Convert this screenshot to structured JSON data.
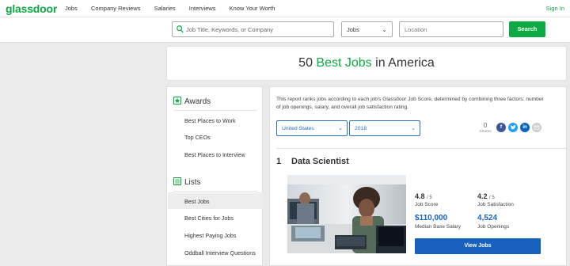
{
  "brand": {
    "logo_text": "glassdoor",
    "accent_color": "#0caa41",
    "link_color": "#1861bf"
  },
  "nav": {
    "links": [
      "Jobs",
      "Company Reviews",
      "Salaries",
      "Interviews",
      "Know Your Worth"
    ],
    "sign_in": "Sign In"
  },
  "search": {
    "keyword_placeholder": "Job Title, Keywords, or Company",
    "category_value": "Jobs",
    "location_placeholder": "Location",
    "button_label": "Search"
  },
  "page": {
    "title_prefix": "50 ",
    "title_accent": "Best Jobs",
    "title_suffix": " in America"
  },
  "sidebar": {
    "awards": {
      "heading": "Awards",
      "items": [
        "Best Places to Work",
        "Top CEOs",
        "Best Places to Interview"
      ]
    },
    "lists": {
      "heading": "Lists",
      "items": [
        "Best Jobs",
        "Best Cities for Jobs",
        "Highest Paying Jobs",
        "Oddball Interview Questions"
      ],
      "selected": "Best Jobs"
    }
  },
  "report": {
    "description": "This report ranks jobs according to each job's Glassdoor Job Score, determined by combining three factors: number of job openings, salary, and overall job satisfaction rating.",
    "country": "United States",
    "year": "2018",
    "share_count": "0",
    "share_label": "Shares",
    "share_icons": [
      "facebook-icon",
      "twitter-icon",
      "linkedin-icon",
      "email-icon"
    ]
  },
  "job": {
    "rank": "1",
    "title": "Data Scientist",
    "job_score": "4.8",
    "job_score_out_of": "/ 5",
    "job_score_label": "Job Score",
    "job_satisfaction": "4.2",
    "job_satisfaction_out_of": "/ 5",
    "job_satisfaction_label": "Job Satisfaction",
    "salary": "$110,000",
    "salary_label": "Median Base Salary",
    "openings": "4,524",
    "openings_label": "Job Openings",
    "view_button": "View Jobs"
  }
}
